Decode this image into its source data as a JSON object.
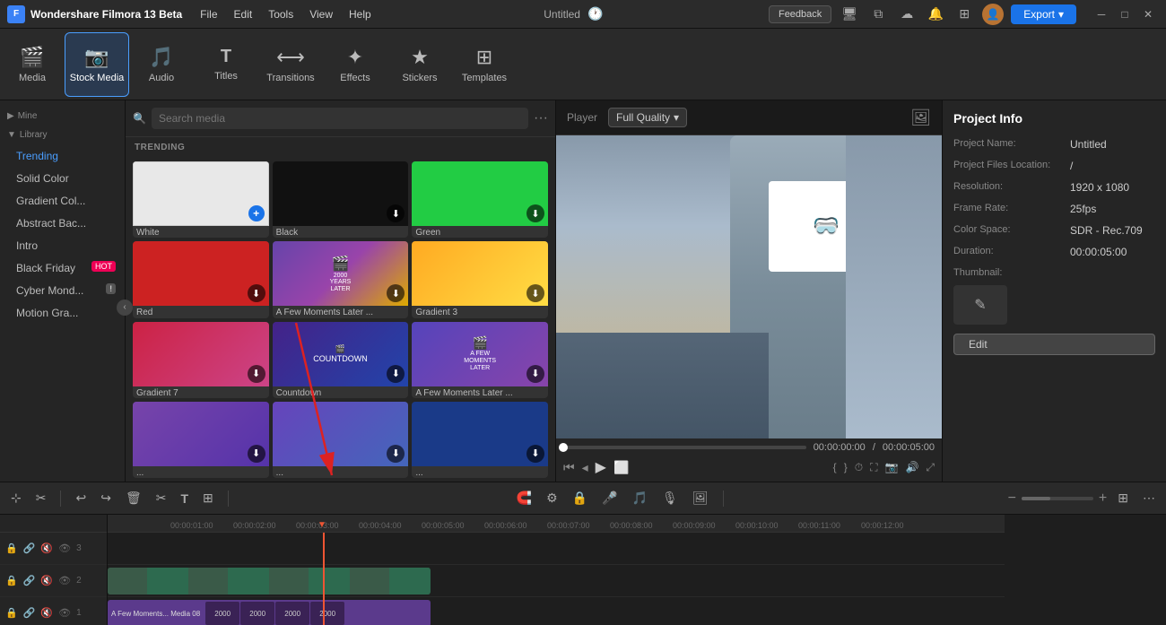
{
  "app": {
    "name": "Wondershare Filmora 13 Beta",
    "title": "Untitled",
    "export_label": "Export",
    "export_dropdown": "▾"
  },
  "menus": [
    "File",
    "Edit",
    "Tools",
    "View",
    "Help"
  ],
  "toolbar": {
    "items": [
      {
        "id": "media",
        "label": "Media",
        "icon": "🎬"
      },
      {
        "id": "stock-media",
        "label": "Stock Media",
        "icon": "📷",
        "active": true
      },
      {
        "id": "audio",
        "label": "Audio",
        "icon": "🎵"
      },
      {
        "id": "titles",
        "label": "Titles",
        "icon": "T"
      },
      {
        "id": "transitions",
        "label": "Transitions",
        "icon": "⟷"
      },
      {
        "id": "effects",
        "label": "Effects",
        "icon": "✦"
      },
      {
        "id": "stickers",
        "label": "Stickers",
        "icon": "★"
      },
      {
        "id": "templates",
        "label": "Templates",
        "icon": "⊞"
      }
    ]
  },
  "sidebar": {
    "sections": [
      {
        "id": "mine",
        "label": "Mine",
        "collapsed": true
      },
      {
        "id": "library",
        "label": "Library",
        "collapsed": false
      }
    ],
    "items": [
      {
        "id": "trending",
        "label": "Trending",
        "active": true
      },
      {
        "id": "solid-color",
        "label": "Solid Color"
      },
      {
        "id": "gradient-col",
        "label": "Gradient Col..."
      },
      {
        "id": "abstract-bac",
        "label": "Abstract Bac..."
      },
      {
        "id": "intro",
        "label": "Intro"
      },
      {
        "id": "black-friday",
        "label": "Black Friday",
        "badge": "HOT",
        "badge_type": "hot"
      },
      {
        "id": "cyber-mond",
        "label": "Cyber Mond...",
        "badge": "!",
        "badge_type": "new"
      },
      {
        "id": "motion-gra",
        "label": "Motion Gra..."
      }
    ]
  },
  "media_panel": {
    "search_placeholder": "Search media",
    "section_label": "TRENDING",
    "items": [
      {
        "id": "white",
        "label": "White",
        "bg": "#ffffff",
        "has_add": true
      },
      {
        "id": "black",
        "label": "Black",
        "bg": "#111111",
        "has_add": false
      },
      {
        "id": "green",
        "label": "Green",
        "bg": "#22cc44",
        "has_download": true
      },
      {
        "id": "red",
        "label": "Red",
        "bg": "#dd2222",
        "has_download": true
      },
      {
        "id": "few-moments-later",
        "label": "A Few Moments Later ...",
        "type": "animated",
        "has_download": true
      },
      {
        "id": "gradient3",
        "label": "Gradient 3",
        "bg": "linear-gradient(135deg, #ffa040, #ffdd00)",
        "has_download": true
      },
      {
        "id": "gradient7",
        "label": "Gradient 7",
        "bg": "linear-gradient(135deg, #cc2244, #cc4488)",
        "has_download": true
      },
      {
        "id": "countdown",
        "label": "Countdown",
        "bg": "linear-gradient(135deg, #8822aa, #4488cc)",
        "has_download": true
      },
      {
        "id": "few-moments2",
        "label": "A Few Moments Later ...",
        "type": "animated2",
        "has_download": true
      },
      {
        "id": "item10",
        "label": "...",
        "bg": "#8844aa",
        "has_download": true
      },
      {
        "id": "item11",
        "label": "...",
        "bg": "linear-gradient(135deg, #7744bb, #4466bb)",
        "has_download": true
      },
      {
        "id": "item12",
        "label": "...",
        "bg": "#2244aa",
        "has_download": true
      }
    ]
  },
  "preview": {
    "label": "Player",
    "quality": "Full Quality",
    "time_current": "00:00:00:00",
    "time_total": "/ 00:00:05:00"
  },
  "project_info": {
    "title": "Project Info",
    "fields": [
      {
        "label": "Project Name:",
        "value": "Untitled"
      },
      {
        "label": "Project Files Location:",
        "value": "/"
      },
      {
        "label": "Resolution:",
        "value": "1920 x 1080"
      },
      {
        "label": "Frame Rate:",
        "value": "25fps"
      },
      {
        "label": "Color Space:",
        "value": "SDR - Rec.709"
      },
      {
        "label": "Duration:",
        "value": "00:00:05:00"
      },
      {
        "label": "Thumbnail:",
        "value": ""
      }
    ],
    "edit_label": "Edit",
    "edit_icon": "✎"
  },
  "timeline": {
    "ruler_marks": [
      "00:00:01:00",
      "00:00:02:00",
      "00:00:03:00",
      "00:00:04:00",
      "00:00:05:00",
      "00:00:06:00",
      "00:00:07:00",
      "00:00:08:00",
      "00:00:09:00",
      "00:00:10:00",
      "00:00:11:00",
      "00:00:12:00"
    ],
    "tracks": [
      {
        "num": "3",
        "type": "video"
      },
      {
        "num": "2",
        "type": "overlay"
      },
      {
        "num": "1",
        "type": "video"
      }
    ],
    "toolbar_buttons": [
      "↩",
      "↪",
      "🗑",
      "✂",
      "T",
      "⊞"
    ],
    "zoom_level": "40"
  },
  "drag_arrow": {
    "visible": true
  }
}
